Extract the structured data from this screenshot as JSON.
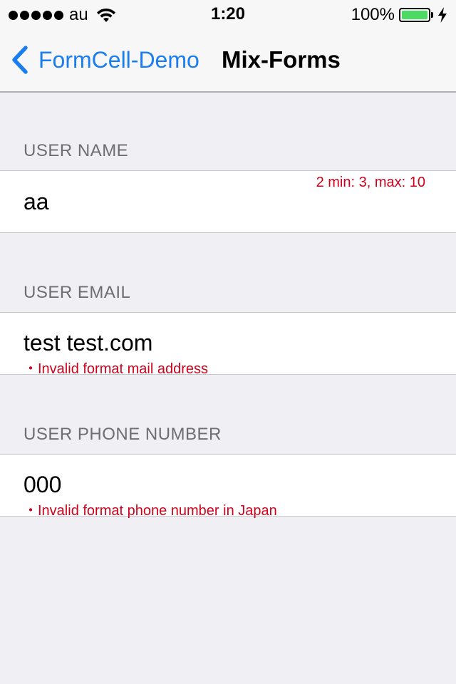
{
  "status_bar": {
    "carrier": "au",
    "time": "1:20",
    "battery_percent": "100%",
    "battery_level": 1.0,
    "battery_color": "#4cd964"
  },
  "nav": {
    "back_label": "FormCell-Demo",
    "title": "Mix-Forms",
    "accent_color": "#1a7ef0"
  },
  "form": {
    "user_name": {
      "header": "USER NAME",
      "value": "aa",
      "error": "2 min: 3, max: 10"
    },
    "user_email": {
      "header": "USER EMAIL",
      "value": "test test.com",
      "error": "・Invalid format mail address"
    },
    "user_phone": {
      "header": "USER PHONE NUMBER",
      "value": "000",
      "error": "・Invalid format phone number in Japan"
    },
    "error_color": "#d0021b"
  }
}
